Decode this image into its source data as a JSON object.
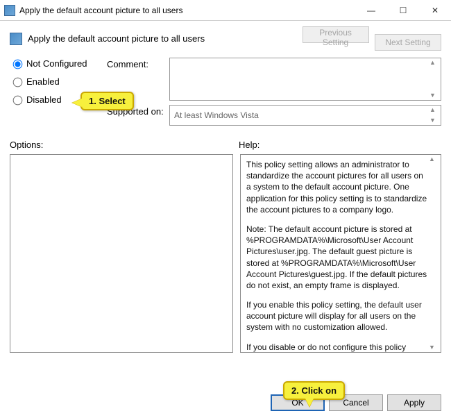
{
  "titlebar": {
    "title": "Apply the default account picture to all users"
  },
  "header": {
    "title": "Apply the default account picture to all users"
  },
  "nav": {
    "previous": "Previous Setting",
    "next": "Next Setting"
  },
  "state": {
    "not_configured": "Not Configured",
    "enabled": "Enabled",
    "disabled": "Disabled",
    "selected": "not_configured"
  },
  "labels": {
    "comment": "Comment:",
    "supported_on": "Supported on:",
    "options": "Options:",
    "help": "Help:"
  },
  "comment": {
    "value": ""
  },
  "supported_on": {
    "value": "At least Windows Vista"
  },
  "help": {
    "p1": "This policy setting allows an administrator to standardize the account pictures for all users on a system to the default account picture. One application for this policy setting is to standardize the account pictures to a company logo.",
    "p2": "Note: The default account picture is stored at %PROGRAMDATA%\\Microsoft\\User Account Pictures\\user.jpg. The default guest picture is stored at %PROGRAMDATA%\\Microsoft\\User Account Pictures\\guest.jpg. If the default pictures do not exist, an empty frame is displayed.",
    "p3": "If you enable this policy setting, the default user account picture will display for all users on the system with no customization allowed.",
    "p4": "If you disable or do not configure this policy setting, users will be able to customize their account pictures."
  },
  "footer": {
    "ok": "OK",
    "cancel": "Cancel",
    "apply": "Apply"
  },
  "annotations": {
    "select": "1.  Select",
    "click": "2.  Click on"
  }
}
